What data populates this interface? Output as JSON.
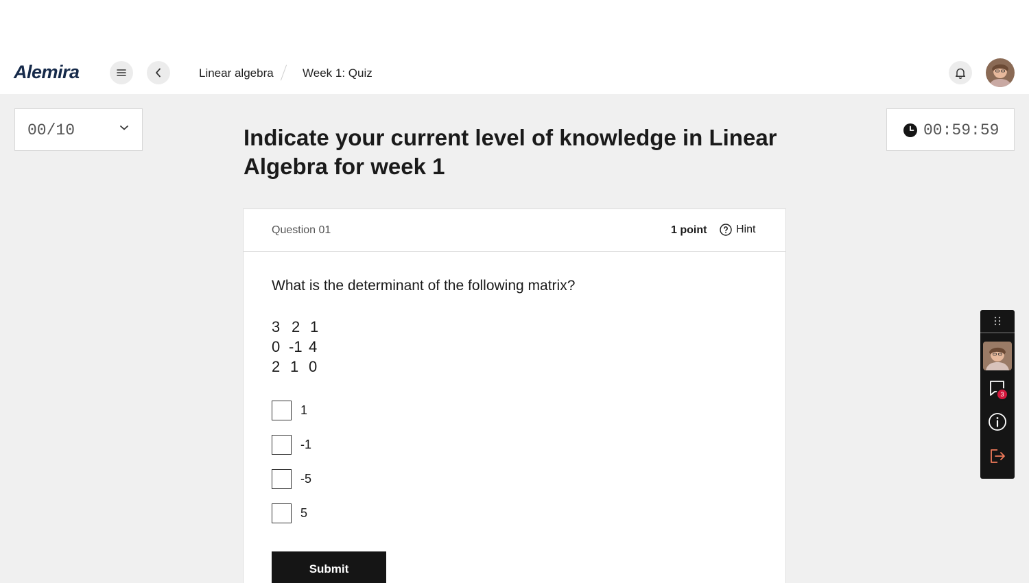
{
  "app": {
    "logo": "Alemira"
  },
  "breadcrumb": {
    "course": "Linear algebra",
    "page": "Week 1: Quiz"
  },
  "icons": {
    "menu": "hamburger-icon",
    "back": "chevron-left-icon",
    "bell": "bell-icon",
    "timer": "clock-icon",
    "hint": "question-circle-icon",
    "drag": "drag-handle-icon",
    "chat": "chat-icon",
    "info": "info-icon",
    "exit": "exit-icon"
  },
  "progress": {
    "value": "00/10"
  },
  "timer": {
    "value": "00:59:59"
  },
  "quiz": {
    "title": "Indicate your current level of knowledge in Linear Algebra for week 1"
  },
  "question": {
    "number": "Question 01",
    "points": "1 point",
    "hint_label": "Hint",
    "text": "What is the determinant of the following matrix?",
    "matrix": [
      [
        "3",
        "2",
        "1"
      ],
      [
        "0",
        "-1",
        "4"
      ],
      [
        "2",
        "1",
        "0"
      ]
    ],
    "options": [
      "1",
      "-1",
      "-5",
      "5"
    ],
    "submit_label": "Submit"
  },
  "side_panel": {
    "chat_badge": "3"
  },
  "colors": {
    "primary": "#151515",
    "badge": "#d3183d",
    "logo": "#162a4a",
    "exit_icon": "#f07a5a"
  }
}
